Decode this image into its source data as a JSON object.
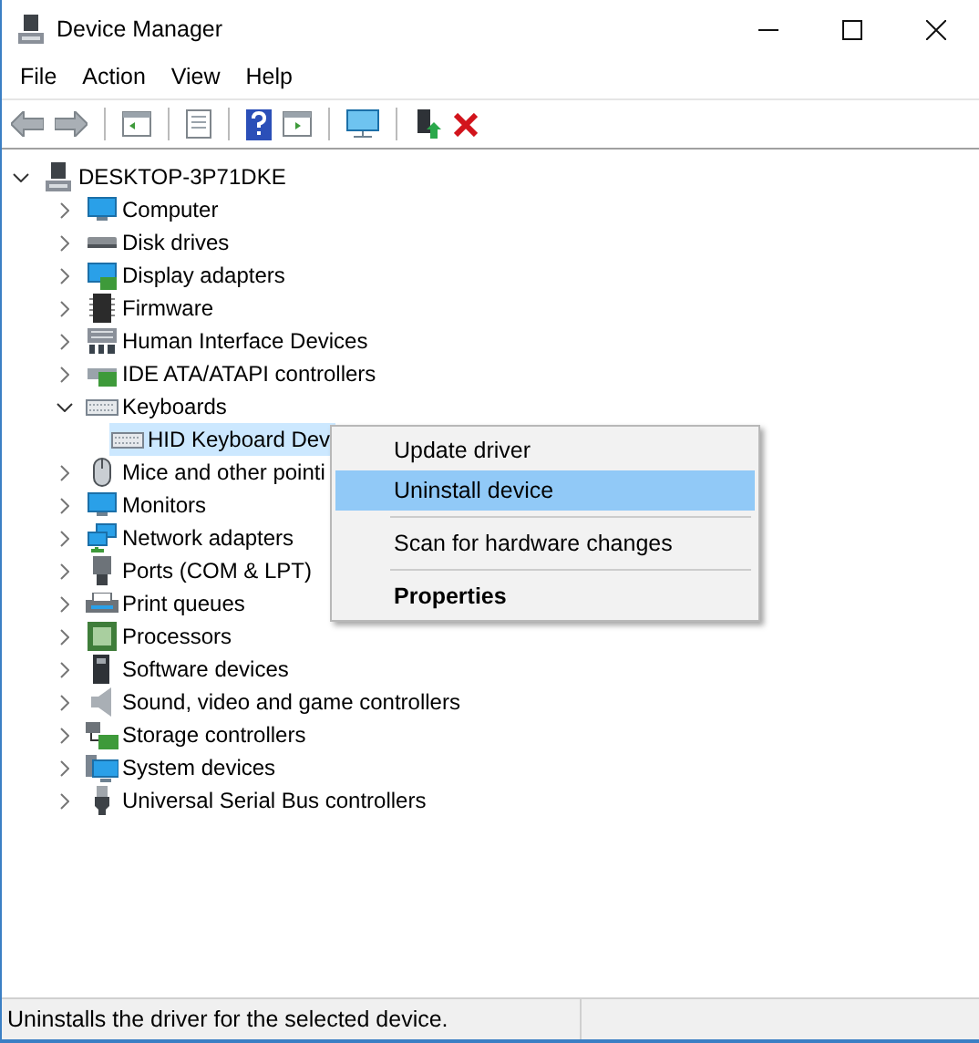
{
  "window": {
    "title": "Device Manager"
  },
  "menu_bar": [
    "File",
    "Action",
    "View",
    "Help"
  ],
  "tree": {
    "label": "DESKTOP-3P71DKE",
    "expanded": true,
    "selected": false,
    "children": [
      {
        "label": "Computer",
        "expanded": false,
        "selected": false
      },
      {
        "label": "Disk drives",
        "expanded": false,
        "selected": false
      },
      {
        "label": "Display adapters",
        "expanded": false,
        "selected": false
      },
      {
        "label": "Firmware",
        "expanded": false,
        "selected": false
      },
      {
        "label": "Human Interface Devices",
        "expanded": false,
        "selected": false
      },
      {
        "label": "IDE ATA/ATAPI controllers",
        "expanded": false,
        "selected": false
      },
      {
        "label": "Keyboards",
        "expanded": true,
        "selected": false,
        "children": [
          {
            "label": "HID Keyboard Dev",
            "selected": true
          }
        ]
      },
      {
        "label": "Mice and other pointi",
        "expanded": false,
        "selected": false
      },
      {
        "label": "Monitors",
        "expanded": false,
        "selected": false
      },
      {
        "label": "Network adapters",
        "expanded": false,
        "selected": false
      },
      {
        "label": "Ports (COM & LPT)",
        "expanded": false,
        "selected": false
      },
      {
        "label": "Print queues",
        "expanded": false,
        "selected": false
      },
      {
        "label": "Processors",
        "expanded": false,
        "selected": false
      },
      {
        "label": "Software devices",
        "expanded": false,
        "selected": false
      },
      {
        "label": "Sound, video and game controllers",
        "expanded": false,
        "selected": false
      },
      {
        "label": "Storage controllers",
        "expanded": false,
        "selected": false
      },
      {
        "label": "System devices",
        "expanded": false,
        "selected": false
      },
      {
        "label": "Universal Serial Bus controllers",
        "expanded": false,
        "selected": false
      }
    ]
  },
  "context_menu": [
    {
      "kind": "command",
      "label": "Update driver",
      "selected": false
    },
    {
      "kind": "command",
      "label": "Uninstall device",
      "selected": true
    },
    {
      "kind": "separator"
    },
    {
      "kind": "command",
      "label": "Scan for hardware changes",
      "selected": false
    },
    {
      "kind": "separator"
    },
    {
      "kind": "default",
      "label": "Properties",
      "selected": false
    }
  ],
  "status_bar": "Uninstalls the driver for the selected device."
}
